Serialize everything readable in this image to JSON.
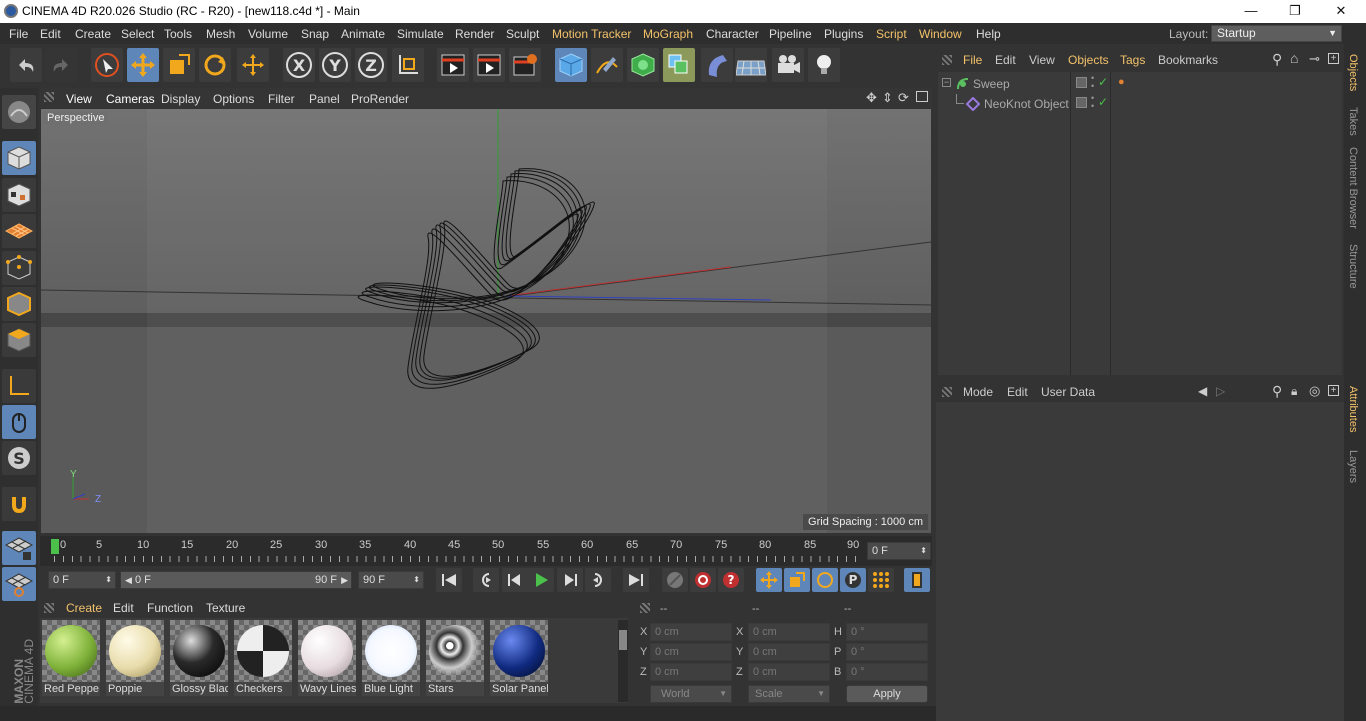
{
  "window": {
    "title": "CINEMA 4D R20.026 Studio (RC - R20) - [new118.c4d *] - Main",
    "minimize": "—",
    "maximize": "❐",
    "close": "✕"
  },
  "menubar": {
    "items": [
      "File",
      "Edit",
      "Create",
      "Select",
      "Tools",
      "Mesh",
      "Volume",
      "Snap",
      "Animate",
      "Simulate",
      "Render",
      "Sculpt",
      "Motion Tracker",
      "MoGraph",
      "Character",
      "Pipeline",
      "Plugins",
      "Script",
      "Window",
      "Help"
    ],
    "layout_label": "Layout:",
    "layout_value": "Startup"
  },
  "viewport": {
    "menu": [
      "View",
      "Cameras",
      "Display",
      "Options",
      "Filter",
      "Panel",
      "ProRender"
    ],
    "camera_label": "Perspective",
    "grid_spacing": "Grid Spacing : 1000 cm",
    "axis_y": "Y",
    "axis_z": "Z"
  },
  "timeline": {
    "ticks": [
      "0",
      "5",
      "10",
      "15",
      "20",
      "25",
      "30",
      "35",
      "40",
      "45",
      "50",
      "55",
      "60",
      "65",
      "70",
      "75",
      "80",
      "85",
      "90"
    ],
    "current_frame_field": "0 F",
    "start_field": "0 F",
    "range_start": "0 F",
    "range_end": "90 F",
    "end_field": "90 F"
  },
  "materials": {
    "menu": [
      "Create",
      "Edit",
      "Function",
      "Texture"
    ],
    "items": [
      {
        "name": "Red Peppe",
        "color": "#7fb23a"
      },
      {
        "name": "Poppie",
        "color": "#e8dcab"
      },
      {
        "name": "Glossy Blac",
        "color": "#2a2a2a"
      },
      {
        "name": "Checkers",
        "color": "#d8d8d8"
      },
      {
        "name": "Wavy Lines",
        "color": "#e8dde0"
      },
      {
        "name": "Blue Light",
        "color": "#f4f8ff"
      },
      {
        "name": "Stars",
        "color": "#cccccc"
      },
      {
        "name": "Solar Panel",
        "color": "#102a80"
      }
    ]
  },
  "coordinates": {
    "headers": [
      "--",
      "--",
      "--"
    ],
    "rows": [
      {
        "l1": "X",
        "v1": "0 cm",
        "l2": "X",
        "v2": "0 cm",
        "l3": "H",
        "v3": "0 °"
      },
      {
        "l1": "Y",
        "v1": "0 cm",
        "l2": "Y",
        "v2": "0 cm",
        "l3": "P",
        "v3": "0 °"
      },
      {
        "l1": "Z",
        "v1": "0 cm",
        "l2": "Z",
        "v2": "0 cm",
        "l3": "B",
        "v3": "0 °"
      }
    ],
    "mode_world": "World",
    "mode_scale": "Scale",
    "apply": "Apply"
  },
  "objects": {
    "menu": [
      "File",
      "Edit",
      "View",
      "Objects",
      "Tags",
      "Bookmarks"
    ],
    "items": [
      {
        "name": "Sweep"
      },
      {
        "name": "NeoKnot Object"
      }
    ]
  },
  "attributes": {
    "menu": [
      "Mode",
      "Edit",
      "User Data"
    ]
  },
  "right_tabs": {
    "top": [
      "Objects",
      "Takes",
      "Content Browser",
      "Structure"
    ],
    "bottom": [
      "Attributes",
      "Layers"
    ]
  },
  "brand": {
    "line1": "MAXON",
    "line2": "CINEMA 4D"
  },
  "colors": {
    "accent": "#f3c26a",
    "active_tool": "#5f86b8",
    "axis_x": "#d03030",
    "axis_y": "#30a030",
    "axis_z": "#3040c0"
  }
}
